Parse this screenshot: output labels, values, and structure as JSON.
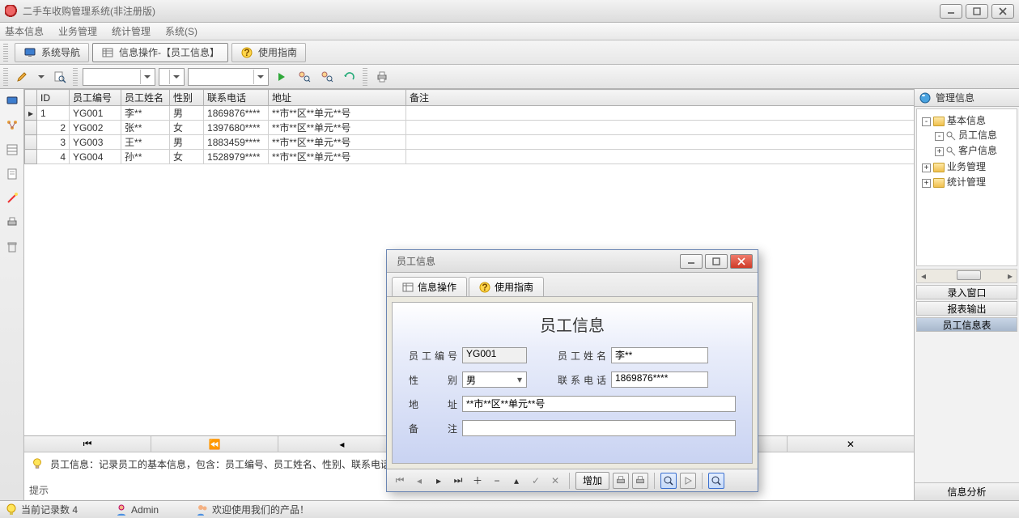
{
  "window_title": "二手车收购管理系统(非注册版)",
  "menu_items": [
    "基本信息",
    "业务管理",
    "统计管理",
    "系统(S)"
  ],
  "tabs": {
    "nav_label": "系统导航",
    "info_label": "信息操作-【员工信息】",
    "guide_label": "使用指南"
  },
  "grid": {
    "headers": [
      "ID",
      "员工编号",
      "员工姓名",
      "性别",
      "联系电话",
      "地址",
      "备注"
    ],
    "rows": [
      [
        "1",
        "YG001",
        "李**",
        "男",
        "1869876****",
        "**市**区**单元**号",
        ""
      ],
      [
        "2",
        "YG002",
        "张**",
        "女",
        "1397680****",
        "**市**区**单元**号",
        ""
      ],
      [
        "3",
        "YG003",
        "王**",
        "男",
        "1883459****",
        "**市**区**单元**号",
        ""
      ],
      [
        "4",
        "YG004",
        "孙**",
        "女",
        "1528979****",
        "**市**区**单元**号",
        ""
      ]
    ]
  },
  "hint_text": "员工信息：记录员工的基本信息，包含：员工编号、员工姓名、性别、联系电话、地址等内容。",
  "hint_label": "提示",
  "right_panel": {
    "header": "管理信息",
    "tree": {
      "root": "基本信息",
      "children": [
        "员工信息",
        "客户信息"
      ],
      "siblings": [
        "业务管理",
        "统计管理"
      ]
    },
    "buttons": {
      "entry": "录入窗口",
      "report": "报表输出",
      "emp_table": "员工信息表"
    },
    "footer": "信息分析"
  },
  "dialog": {
    "title": "员工信息",
    "tab_info": "信息操作",
    "tab_guide": "使用指南",
    "heading": "员工信息",
    "labels": {
      "id": "员工编号",
      "name": "员工姓名",
      "sex": "性    别",
      "tel": "联系电话",
      "addr": "地    址",
      "remark": "备    注"
    },
    "fields": {
      "id": "YG001",
      "name": "李**",
      "sex": "男",
      "tel": "1869876****",
      "addr": "**市**区**单元**号",
      "remark": ""
    },
    "add_btn": "增加"
  },
  "status": {
    "count_label": "当前记录数 4",
    "user_label": "Admin",
    "welcome": "欢迎使用我们的产品！"
  }
}
